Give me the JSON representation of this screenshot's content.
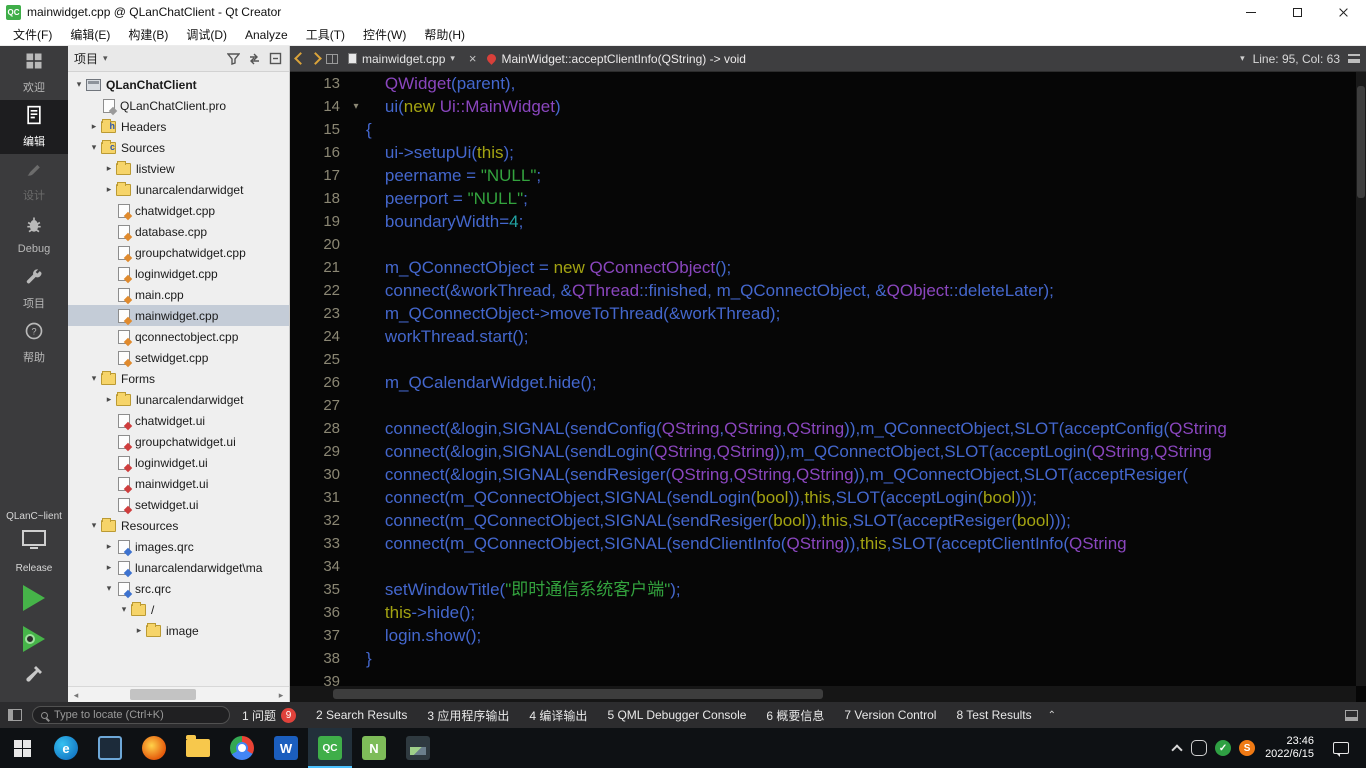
{
  "title_bar": {
    "title": "mainwidget.cpp @ QLanChatClient - Qt Creator"
  },
  "menu_bar": {
    "items": [
      "文件(F)",
      "编辑(E)",
      "构建(B)",
      "调试(D)",
      "Analyze",
      "工具(T)",
      "控件(W)",
      "帮助(H)"
    ]
  },
  "mode_sidebar": {
    "modes": [
      {
        "label": "欢迎",
        "icon": "welcome-grid-icon",
        "selected": false,
        "disabled": false
      },
      {
        "label": "编辑",
        "icon": "edit-document-icon",
        "selected": true,
        "disabled": false
      },
      {
        "label": "设计",
        "icon": "design-brush-icon",
        "selected": false,
        "disabled": true
      },
      {
        "label": "Debug",
        "icon": "debug-bug-icon",
        "selected": false,
        "disabled": false
      },
      {
        "label": "项目",
        "icon": "projects-wrench-icon",
        "selected": false,
        "disabled": false
      },
      {
        "label": "帮助",
        "icon": "help-question-icon",
        "selected": false,
        "disabled": false
      }
    ],
    "kit": {
      "project": "QLanC~lient",
      "config": "Release"
    }
  },
  "project_panel": {
    "header": {
      "title": "项目",
      "caret": "▾"
    },
    "tree": [
      {
        "label": "QLanChatClient",
        "depth": 0,
        "icon": "project",
        "state": "e",
        "sel": false,
        "bold": true
      },
      {
        "label": "QLanChatClient.pro",
        "depth": 1,
        "icon": "pro",
        "state": null,
        "sel": false
      },
      {
        "label": "Headers",
        "depth": 1,
        "icon": "folder",
        "letter": "h",
        "state": "c",
        "sel": false
      },
      {
        "label": "Sources",
        "depth": 1,
        "icon": "folder",
        "letter": "c",
        "state": "e",
        "sel": false
      },
      {
        "label": "listview",
        "depth": 2,
        "icon": "folder",
        "state": "c",
        "sel": false
      },
      {
        "label": "lunarcalendarwidget",
        "depth": 2,
        "icon": "folder",
        "state": "c",
        "sel": false
      },
      {
        "label": "chatwidget.cpp",
        "depth": 2,
        "icon": "cpp",
        "state": null,
        "sel": false
      },
      {
        "label": "database.cpp",
        "depth": 2,
        "icon": "cpp",
        "state": null,
        "sel": false
      },
      {
        "label": "groupchatwidget.cpp",
        "depth": 2,
        "icon": "cpp",
        "state": null,
        "sel": false
      },
      {
        "label": "loginwidget.cpp",
        "depth": 2,
        "icon": "cpp",
        "state": null,
        "sel": false
      },
      {
        "label": "main.cpp",
        "depth": 2,
        "icon": "cpp",
        "state": null,
        "sel": false
      },
      {
        "label": "mainwidget.cpp",
        "depth": 2,
        "icon": "cpp",
        "state": null,
        "sel": true
      },
      {
        "label": "qconnectobject.cpp",
        "depth": 2,
        "icon": "cpp",
        "state": null,
        "sel": false
      },
      {
        "label": "setwidget.cpp",
        "depth": 2,
        "icon": "cpp",
        "state": null,
        "sel": false
      },
      {
        "label": "Forms",
        "depth": 1,
        "icon": "folder",
        "state": "e",
        "sel": false
      },
      {
        "label": "lunarcalendarwidget",
        "depth": 2,
        "icon": "folder",
        "state": "c",
        "sel": false
      },
      {
        "label": "chatwidget.ui",
        "depth": 2,
        "icon": "ui",
        "state": null,
        "sel": false
      },
      {
        "label": "groupchatwidget.ui",
        "depth": 2,
        "icon": "ui",
        "state": null,
        "sel": false
      },
      {
        "label": "loginwidget.ui",
        "depth": 2,
        "icon": "ui",
        "state": null,
        "sel": false
      },
      {
        "label": "mainwidget.ui",
        "depth": 2,
        "icon": "ui",
        "state": null,
        "sel": false
      },
      {
        "label": "setwidget.ui",
        "depth": 2,
        "icon": "ui",
        "state": null,
        "sel": false
      },
      {
        "label": "Resources",
        "depth": 1,
        "icon": "folder",
        "state": "e",
        "sel": false
      },
      {
        "label": "images.qrc",
        "depth": 2,
        "icon": "qrc",
        "state": "c",
        "sel": false
      },
      {
        "label": "lunarcalendarwidget\\ma",
        "depth": 2,
        "icon": "qrc",
        "state": "c",
        "sel": false
      },
      {
        "label": "src.qrc",
        "depth": 2,
        "icon": "qrc",
        "state": "e",
        "sel": false
      },
      {
        "label": "/",
        "depth": 3,
        "icon": "folder",
        "state": "e",
        "sel": false
      },
      {
        "label": "image",
        "depth": 4,
        "icon": "folder",
        "state": "c",
        "sel": false
      }
    ]
  },
  "editor": {
    "nav": {
      "file": "mainwidget.cpp",
      "symbol": "MainWidget::acceptClientInfo(QString) -> void",
      "line_col": "Line: 95, Col: 63",
      "caret": "▾",
      "close": "×"
    },
    "lines": [
      {
        "no": 13,
        "tokens": [
          [
            "    ",
            "d"
          ],
          [
            "QWidget",
            "t"
          ],
          [
            "(parent),",
            "d"
          ]
        ]
      },
      {
        "no": 14,
        "fold": true,
        "tokens": [
          [
            "    ui(",
            "d"
          ],
          [
            "new ",
            "k"
          ],
          [
            "Ui::MainWidget",
            "t"
          ],
          [
            ")",
            "d"
          ]
        ]
      },
      {
        "no": 15,
        "tokens": [
          [
            "{",
            "d"
          ]
        ]
      },
      {
        "no": 16,
        "tokens": [
          [
            "    ui->setupUi(",
            "d"
          ],
          [
            "this",
            "k"
          ],
          [
            ");",
            "d"
          ]
        ]
      },
      {
        "no": 17,
        "tokens": [
          [
            "    peername = ",
            "d"
          ],
          [
            "\"NULL\"",
            "s"
          ],
          [
            ";",
            "d"
          ]
        ]
      },
      {
        "no": 18,
        "tokens": [
          [
            "    peerport = ",
            "d"
          ],
          [
            "\"NULL\"",
            "s"
          ],
          [
            ";",
            "d"
          ]
        ]
      },
      {
        "no": 19,
        "tokens": [
          [
            "    boundaryWidth=",
            "d"
          ],
          [
            "4",
            "n"
          ],
          [
            ";",
            "d"
          ]
        ]
      },
      {
        "no": 20,
        "tokens": []
      },
      {
        "no": 21,
        "tokens": [
          [
            "    m_QConnectObject = ",
            "d"
          ],
          [
            "new ",
            "k"
          ],
          [
            "QConnectObject",
            "t"
          ],
          [
            "();",
            "d"
          ]
        ]
      },
      {
        "no": 22,
        "tokens": [
          [
            "    connect(&workThread, &",
            "d"
          ],
          [
            "QThread",
            "t"
          ],
          [
            "::finished, m_QConnectObject, &",
            "d"
          ],
          [
            "QObject",
            "t"
          ],
          [
            "::deleteLater);",
            "d"
          ]
        ]
      },
      {
        "no": 23,
        "tokens": [
          [
            "    m_QConnectObject->moveToThread(&workThread);",
            "d"
          ]
        ]
      },
      {
        "no": 24,
        "tokens": [
          [
            "    workThread.start();",
            "d"
          ]
        ]
      },
      {
        "no": 25,
        "tokens": []
      },
      {
        "no": 26,
        "tokens": [
          [
            "    m_QCalendarWidget.hide();",
            "d"
          ]
        ]
      },
      {
        "no": 27,
        "tokens": []
      },
      {
        "no": 28,
        "tokens": [
          [
            "    connect(&login,SIGNAL(sendConfig(",
            "d"
          ],
          [
            "QString",
            "t"
          ],
          [
            ",",
            "d"
          ],
          [
            "QString",
            "t"
          ],
          [
            ",",
            "d"
          ],
          [
            "QString",
            "t"
          ],
          [
            ")),m_QConnectObject,SLOT(acceptConfig(",
            "d"
          ],
          [
            "QString",
            "t"
          ]
        ]
      },
      {
        "no": 29,
        "tokens": [
          [
            "    connect(&login,SIGNAL(sendLogin(",
            "d"
          ],
          [
            "QString",
            "t"
          ],
          [
            ",",
            "d"
          ],
          [
            "QString",
            "t"
          ],
          [
            ")),m_QConnectObject,SLOT(acceptLogin(",
            "d"
          ],
          [
            "QString",
            "t"
          ],
          [
            ",",
            "d"
          ],
          [
            "QString",
            "t"
          ]
        ]
      },
      {
        "no": 30,
        "tokens": [
          [
            "    connect(&login,SIGNAL(sendResiger(",
            "d"
          ],
          [
            "QString",
            "t"
          ],
          [
            ",",
            "d"
          ],
          [
            "QString",
            "t"
          ],
          [
            ",",
            "d"
          ],
          [
            "QString",
            "t"
          ],
          [
            ")),m_QConnectObject,SLOT(acceptResiger(",
            "d"
          ]
        ]
      },
      {
        "no": 31,
        "tokens": [
          [
            "    connect(m_QConnectObject,SIGNAL(sendLogin(",
            "d"
          ],
          [
            "bool",
            "k"
          ],
          [
            ")),",
            "d"
          ],
          [
            "this",
            "k"
          ],
          [
            ",SLOT(acceptLogin(",
            "d"
          ],
          [
            "bool",
            "k"
          ],
          [
            ")));",
            "d"
          ]
        ]
      },
      {
        "no": 32,
        "tokens": [
          [
            "    connect(m_QConnectObject,SIGNAL(sendResiger(",
            "d"
          ],
          [
            "bool",
            "k"
          ],
          [
            ")),",
            "d"
          ],
          [
            "this",
            "k"
          ],
          [
            ",SLOT(acceptResiger(",
            "d"
          ],
          [
            "bool",
            "k"
          ],
          [
            ")));",
            "d"
          ]
        ]
      },
      {
        "no": 33,
        "tokens": [
          [
            "    connect(m_QConnectObject,SIGNAL(sendClientInfo(",
            "d"
          ],
          [
            "QString",
            "t"
          ],
          [
            ")),",
            "d"
          ],
          [
            "this",
            "k"
          ],
          [
            ",SLOT(acceptClientInfo(",
            "d"
          ],
          [
            "QString",
            "t"
          ]
        ]
      },
      {
        "no": 34,
        "tokens": []
      },
      {
        "no": 35,
        "tokens": [
          [
            "    setWindowTitle(",
            "d"
          ],
          [
            "\"即时通信系统客户端\"",
            "s"
          ],
          [
            ");",
            "d"
          ]
        ]
      },
      {
        "no": 36,
        "tokens": [
          [
            "    ",
            "d"
          ],
          [
            "this",
            "k"
          ],
          [
            "->hide();",
            "d"
          ]
        ]
      },
      {
        "no": 37,
        "tokens": [
          [
            "    login.show();",
            "d"
          ]
        ]
      },
      {
        "no": 38,
        "tokens": [
          [
            "}",
            "d"
          ]
        ]
      },
      {
        "no": 39,
        "tokens": []
      }
    ]
  },
  "locator_bar": {
    "placeholder": "Type to locate (Ctrl+K)",
    "panes": [
      {
        "label": "1 问题",
        "badge": "9"
      },
      {
        "label": "2 Search Results"
      },
      {
        "label": "3 应用程序输出"
      },
      {
        "label": "4 编译输出"
      },
      {
        "label": "5 QML Debugger Console"
      },
      {
        "label": "6 概要信息"
      },
      {
        "label": "7 Version Control"
      },
      {
        "label": "8 Test Results"
      }
    ],
    "chevrons": "⌃"
  },
  "taskbar": {
    "apps": [
      {
        "name": "edge",
        "style": "ic-edge tb-circle",
        "letter": "e"
      },
      {
        "name": "explorer-monitor",
        "style": "ic-monitor",
        "letter": ""
      },
      {
        "name": "firefox",
        "style": "ic-firefox tb-circle",
        "letter": ""
      },
      {
        "name": "folder",
        "style": "ic-folder",
        "letter": ""
      },
      {
        "name": "chrome",
        "style": "ic-chrome tb-circle",
        "letter": ""
      },
      {
        "name": "word",
        "style": "ic-word",
        "letter": "W"
      },
      {
        "name": "qtcreator",
        "style": "ic-qc",
        "letter": "QC",
        "active": true
      },
      {
        "name": "notepadpp",
        "style": "ic-npp",
        "letter": "N"
      },
      {
        "name": "screenshot-tool",
        "style": "ic-shot",
        "letter": ""
      }
    ],
    "tray": [
      {
        "name": "tray-device-icon",
        "style": "tray-device",
        "letter": ""
      },
      {
        "name": "tray-security-icon",
        "style": "tray-check",
        "letter": "✓"
      },
      {
        "name": "tray-sogou-icon",
        "style": "tray-sogou",
        "letter": "S"
      }
    ],
    "clock": {
      "time": "23:46",
      "date": "2022/6/15"
    }
  },
  "colors": {
    "accent_green": "#3fae49",
    "badge_red": "#e0423b",
    "string_green": "#33a33e",
    "type_purple": "#8a46be"
  }
}
